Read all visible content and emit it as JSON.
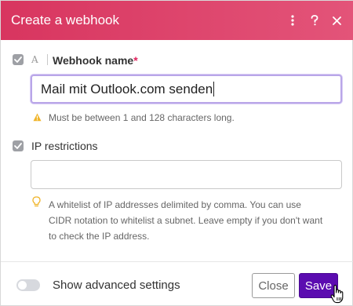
{
  "dialog": {
    "title": "Create a webhook",
    "actions": [
      {
        "name": "more-icon"
      },
      {
        "name": "help-icon"
      },
      {
        "name": "close-icon"
      }
    ]
  },
  "fields": {
    "webhook_name": {
      "label": "Webhook name",
      "required_mark": "*",
      "value": "Mail mit Outlook.com senden",
      "hint": "Must be between 1 and 128 characters long."
    },
    "ip_restrictions": {
      "label": "IP restrictions",
      "value": "",
      "hint_lines": [
        "A whitelist of IP addresses delimited by comma. You can use",
        "CIDR notation to whitelist a subnet. Leave empty if you don't want",
        "to check the IP address."
      ]
    }
  },
  "footer": {
    "advanced_label": "Show advanced settings",
    "advanced_enabled": false,
    "close_label": "Close",
    "save_label": "Save"
  },
  "colors": {
    "header_start": "#d8355f",
    "header_end": "#e35479",
    "save_button": "#5b0cb0",
    "focus_border": "#b9a6e8",
    "warning": "#f0b429"
  }
}
